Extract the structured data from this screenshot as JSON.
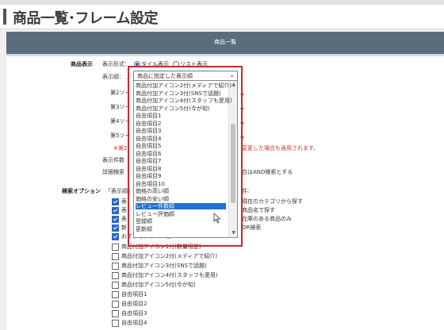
{
  "page": {
    "title": "商品一覧･フレーム設定"
  },
  "panel": {
    "header": "商品一覧"
  },
  "display": {
    "section_label": "商品表示",
    "format_label": "表示形式：",
    "format_options": [
      "タイル表示",
      "リスト表示"
    ],
    "order_label": "表示順：",
    "order_selected": "商品に指定した表示順",
    "sort_rows": [
      "第2ソー",
      "第3ソー",
      "第4ソー",
      "第5ソー"
    ],
    "note": "※第2",
    "note_tail": "変更した場合も適用されます。",
    "count_label": "表示件数",
    "detail_label": "詳細検索",
    "detail_tail": "合はAND検索とする"
  },
  "dropdown": {
    "items": [
      "商品付加アイコン2付(メディアで紹介)",
      "商品付加アイコン3付(SNSで話題)",
      "商品付加アイコン4付(スタッフも愛用)",
      "商品付加アイコン5付(今が旬)",
      "自由項目1",
      "自由項目2",
      "自由項目3",
      "自由項目4",
      "自由項目5",
      "自由項目6",
      "自由項目7",
      "自由項目8",
      "自由項目9",
      "自由項目10",
      "価格の高い順",
      "価格の安い順",
      "レビュー件数順",
      "レビュー評価順",
      "登録順",
      "更新順"
    ],
    "selected_index": 16
  },
  "search_options": {
    "section_label": "検索オプション",
    "lead": "「表示順」",
    "lead_right": "件:",
    "checked_rows": [
      {
        "left": "表",
        "right": "現在のカテゴリから探す"
      },
      {
        "left": "表",
        "right": "商品名で探す"
      },
      {
        "left": "表",
        "right": "在庫のある商品のみ"
      },
      {
        "left": "新",
        "right": "OR検索"
      },
      {
        "left": "おすすめアイコン付",
        "right": ""
      }
    ],
    "unchecked_rows": [
      "商品付加アイコン1付(数量限定)",
      "商品付加アイコン2付(メディアで紹介)",
      "商品付加アイコン3付(SNSで話題)",
      "商品付加アイコン4付(スタッフも愛用)",
      "商品付加アイコン5付(今が旬)",
      "自由項目1",
      "自由項目2",
      "自由項目3",
      "自由項目4"
    ]
  },
  "colors": {
    "header_bg": "#5b6d7d",
    "highlight": "#e0202a",
    "selected": "#1e6fd9"
  }
}
